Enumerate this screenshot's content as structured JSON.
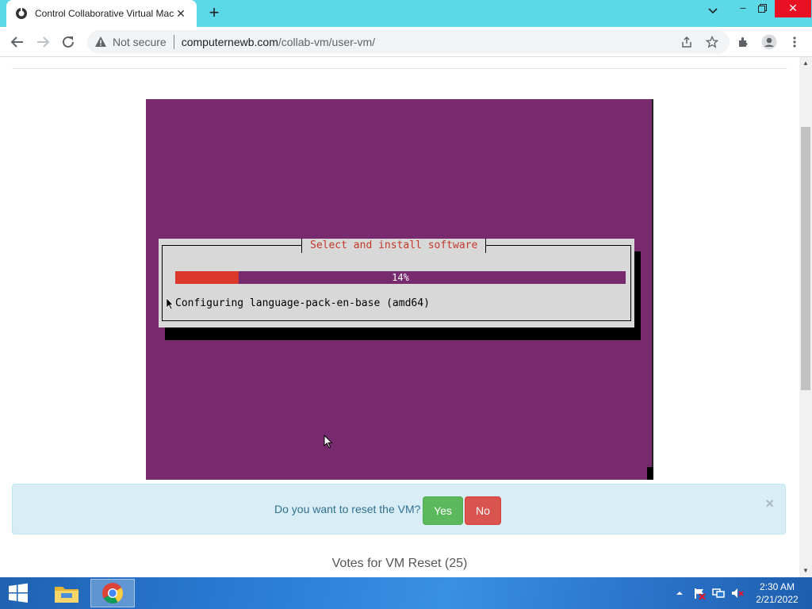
{
  "browser": {
    "tab_title": "Control Collaborative Virtual Machine",
    "omnibox_security": "Not secure",
    "url_host": "computernewb.com",
    "url_path": "/collab-vm/user-vm/"
  },
  "vm": {
    "dialog_title": "Select and install software",
    "progress_percent": 14,
    "progress_label": "14%",
    "status_line": "Configuring language-pack-en-base (amd64)"
  },
  "reset_prompt": {
    "question": "Do you want to reset the VM?",
    "yes_label": "Yes",
    "no_label": "No",
    "close_symbol": "×"
  },
  "votes_text": "Votes for VM Reset (25)",
  "taskbar": {
    "time": "2:30 AM",
    "date": "2/21/2022"
  },
  "colors": {
    "vm_background": "#772a6e",
    "progress_fill": "#d9382a",
    "dialog_title": "#c4392a",
    "yes_button": "#5cb85c",
    "no_button": "#d9534f",
    "alert_bg": "#d9edf7"
  },
  "icons": [
    "favicon-icon",
    "tab-close-icon",
    "new-tab-icon",
    "tab-search-icon",
    "minimize-icon",
    "maximize-icon",
    "close-window-icon",
    "back-icon",
    "forward-icon",
    "reload-icon",
    "warning-icon",
    "share-icon",
    "star-icon",
    "extensions-icon",
    "profile-icon",
    "menu-icon",
    "windows-start-icon",
    "file-explorer-icon",
    "chrome-icon",
    "tray-arrow-icon",
    "action-center-icon",
    "network-icon",
    "volume-muted-icon"
  ]
}
